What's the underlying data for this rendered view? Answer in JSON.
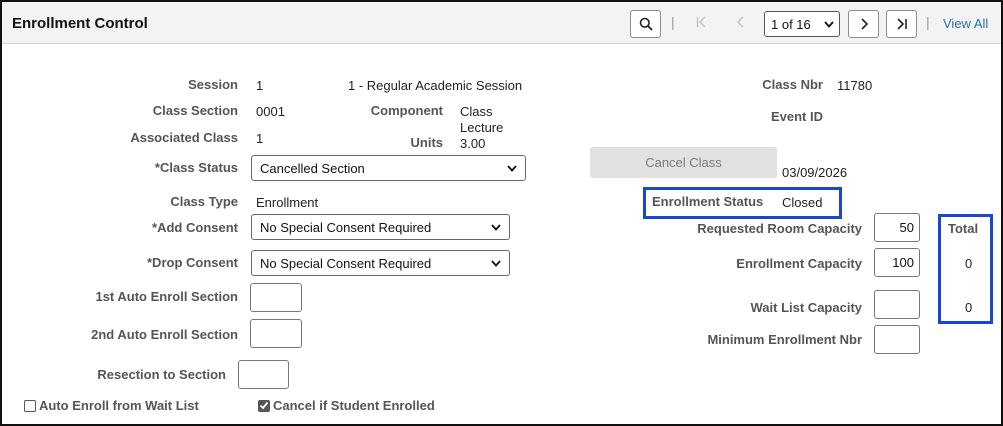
{
  "header": {
    "title": "Enrollment Control",
    "pager_value": "1 of 16",
    "view_all": "View All"
  },
  "fields": {
    "session_label": "Session",
    "session_value": "1",
    "session_desc": "1 - Regular Academic Session",
    "class_nbr_label": "Class Nbr",
    "class_nbr_value": "11780",
    "class_section_label": "Class Section",
    "class_section_value": "0001",
    "component_label": "Component",
    "component_value_line1": "Class",
    "component_value_line2": "Lecture",
    "event_id_label": "Event ID",
    "associated_class_label": "Associated Class",
    "associated_class_value": "1",
    "units_label": "Units",
    "units_value": "3.00",
    "class_status_label": "*Class Status",
    "class_status_value": "Cancelled Section",
    "cancel_class_button": "Cancel Class",
    "cancel_date": "03/09/2026",
    "class_type_label": "Class Type",
    "class_type_value": "Enrollment",
    "enrollment_status_label": "Enrollment Status",
    "enrollment_status_value": "Closed",
    "add_consent_label": "*Add Consent",
    "add_consent_value": "No Special Consent Required",
    "drop_consent_label": "*Drop Consent",
    "drop_consent_value": "No Special Consent Required",
    "first_auto_label": "1st Auto Enroll Section",
    "second_auto_label": "2nd Auto Enroll Section",
    "resection_label": "Resection to Section",
    "auto_enroll_waitlist_label": "Auto Enroll from Wait List",
    "auto_enroll_waitlist_checked": false,
    "cancel_if_enrolled_label": "Cancel if Student Enrolled",
    "cancel_if_enrolled_checked": true
  },
  "capacity": {
    "requested_room_label": "Requested Room Capacity",
    "requested_room_value": "50",
    "enrollment_cap_label": "Enrollment Capacity",
    "enrollment_cap_value": "100",
    "wait_list_label": "Wait List Capacity",
    "wait_list_value": "",
    "min_enroll_label": "Minimum Enrollment Nbr",
    "min_enroll_value": "",
    "total_header": "Total",
    "total_enrollment": "0",
    "total_wait_list": "0"
  },
  "colors": {
    "highlight": "#1a47cf",
    "link": "#2a6db0"
  }
}
